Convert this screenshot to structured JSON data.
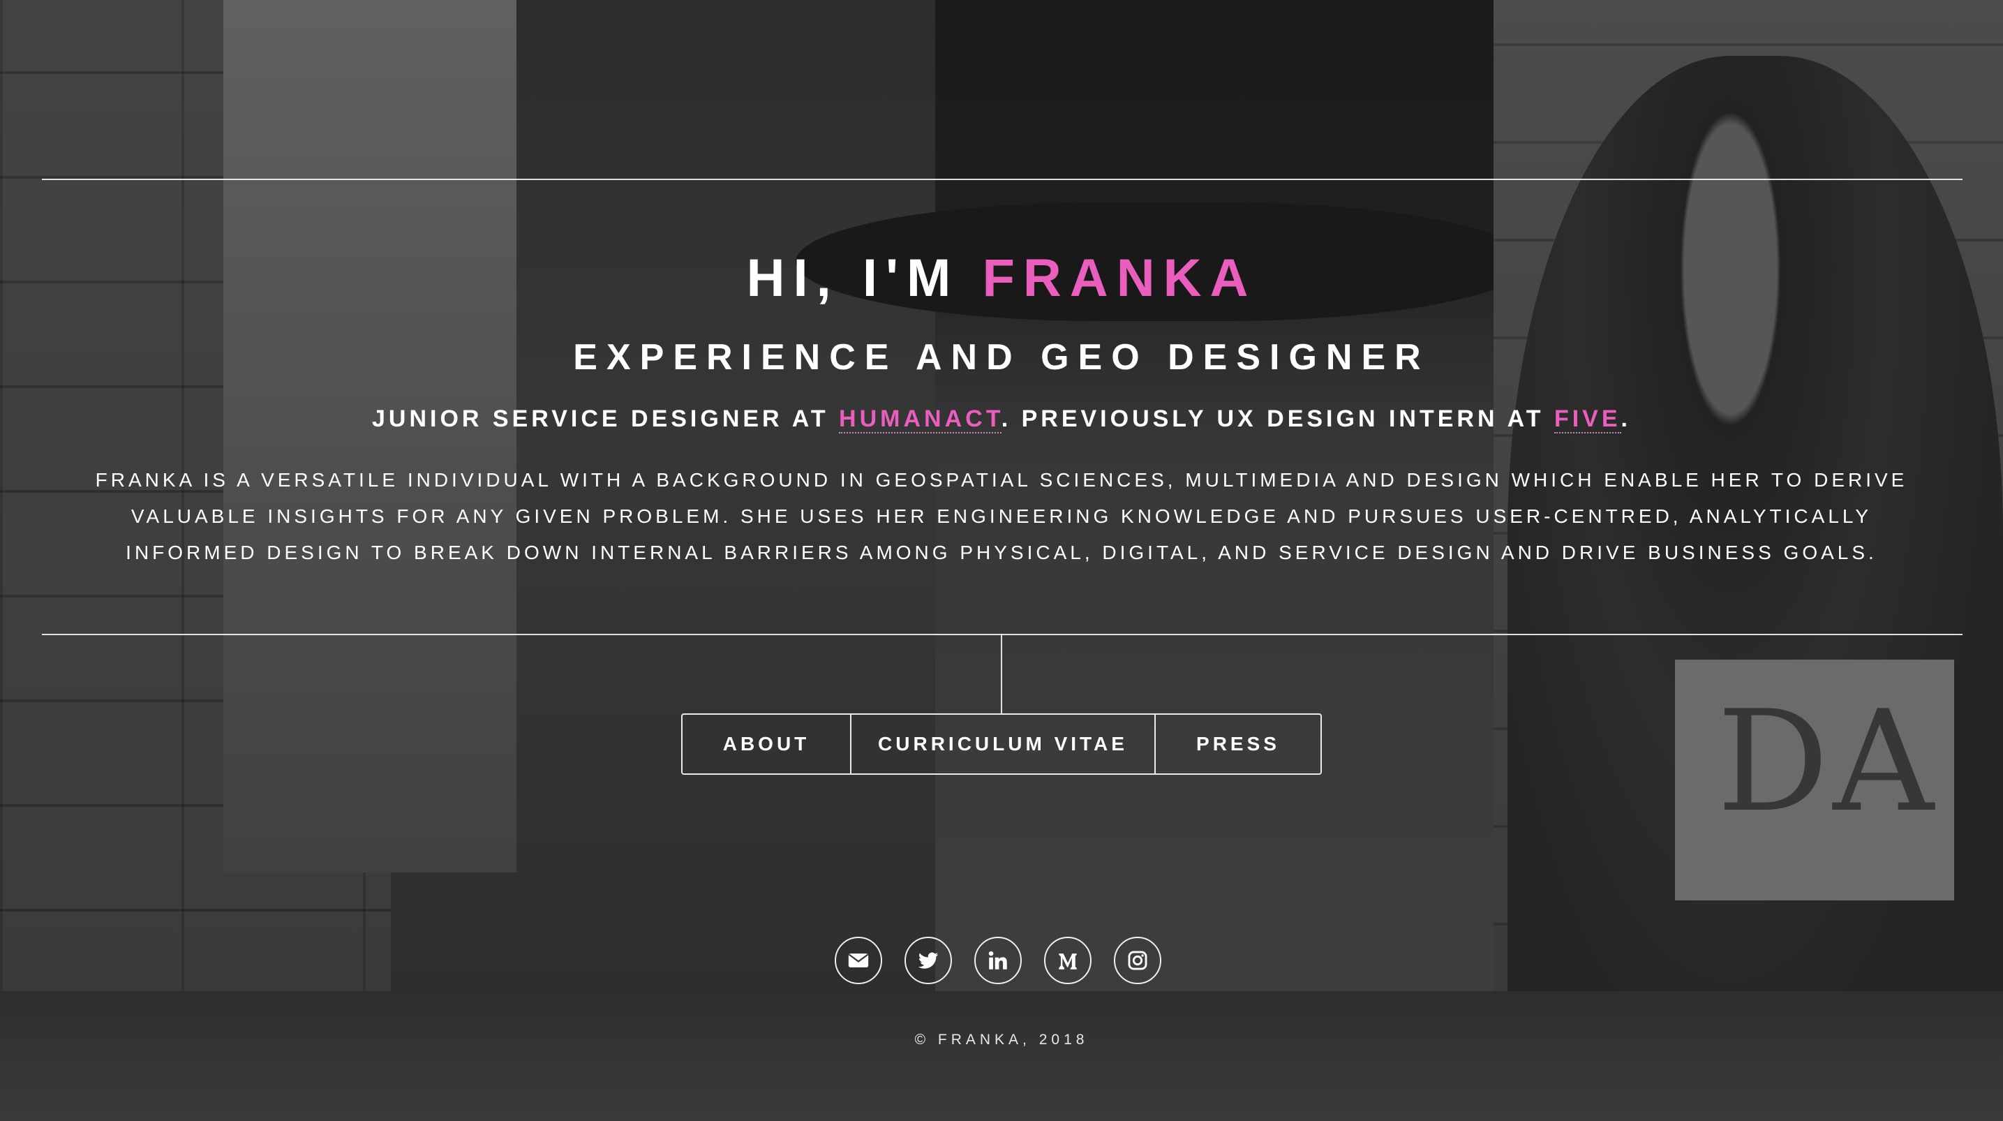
{
  "colors": {
    "accent": "#ea5fbd",
    "text": "#ffffff"
  },
  "hero": {
    "greeting": "HI, I'M",
    "name": "FRANKA",
    "subtitle": "EXPERIENCE AND GEO DESIGNER",
    "role_prefix": "JUNIOR SERVICE DESIGNER AT",
    "role_company": "HUMANACT",
    "role_middle": ". PREVIOUSLY UX DESIGN INTERN AT",
    "role_previous_company": "FIVE",
    "role_suffix": ".",
    "bio": "FRANKA IS A VERSATILE INDIVIDUAL WITH A BACKGROUND IN GEOSPATIAL SCIENCES, MULTIMEDIA AND DESIGN WHICH ENABLE HER TO DERIVE VALUABLE INSIGHTS FOR ANY GIVEN PROBLEM. SHE USES HER ENGINEERING KNOWLEDGE AND PURSUES USER-CENTRED, ANALYTICALLY INFORMED DESIGN TO BREAK DOWN INTERNAL BARRIERS AMONG PHYSICAL, DIGITAL, AND SERVICE DESIGN AND DRIVE BUSINESS GOALS."
  },
  "nav": {
    "about": "ABOUT",
    "cv": "CURRICULUM VITAE",
    "press": "PRESS"
  },
  "social": [
    {
      "icon": "envelope-icon"
    },
    {
      "icon": "twitter-icon"
    },
    {
      "icon": "linkedin-icon"
    },
    {
      "icon": "medium-icon"
    },
    {
      "icon": "instagram-icon"
    }
  ],
  "background": {
    "placard_text": "DA"
  },
  "footer": {
    "copyright": "© FRANKA, 2018"
  }
}
